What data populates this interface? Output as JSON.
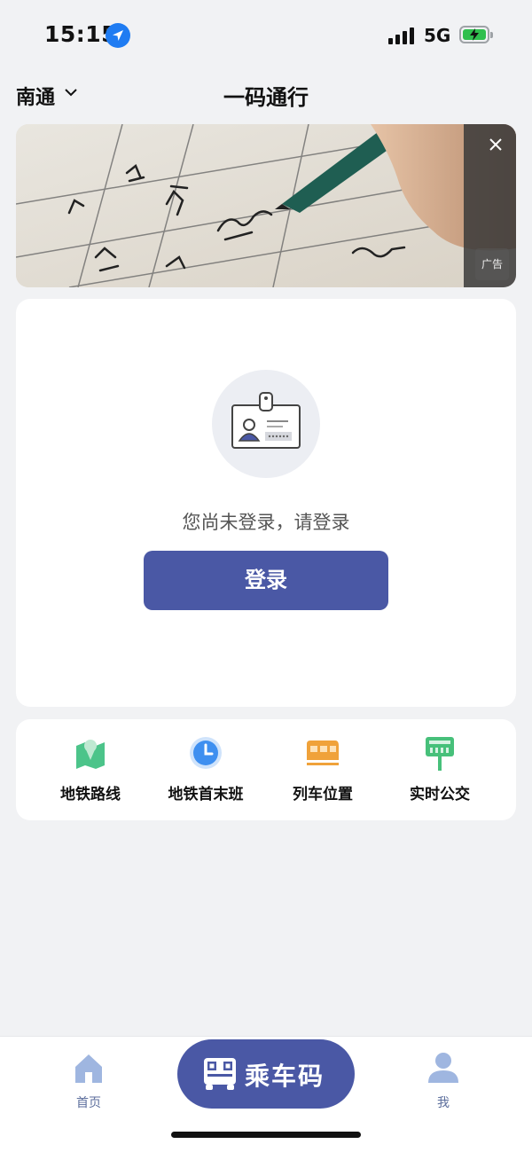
{
  "status": {
    "time": "15:15",
    "network": "5G"
  },
  "header": {
    "city": "南通",
    "title": "一码通行"
  },
  "banner": {
    "ad_label": "广告"
  },
  "login": {
    "message": "您尚未登录，请登录",
    "button": "登录"
  },
  "quick_links": [
    {
      "label": "地铁路线",
      "icon": "map-pin-icon",
      "color": "#4cc48a"
    },
    {
      "label": "地铁首末班",
      "icon": "clock-icon",
      "color": "#3e8ff0"
    },
    {
      "label": "列车位置",
      "icon": "train-icon",
      "color": "#f0a23a"
    },
    {
      "label": "实时公交",
      "icon": "bus-stop-icon",
      "color": "#47c07a"
    }
  ],
  "tabbar": {
    "home": "首页",
    "ride": "乘车码",
    "me": "我"
  },
  "colors": {
    "accent": "#4a58a5",
    "background": "#f1f2f4"
  }
}
